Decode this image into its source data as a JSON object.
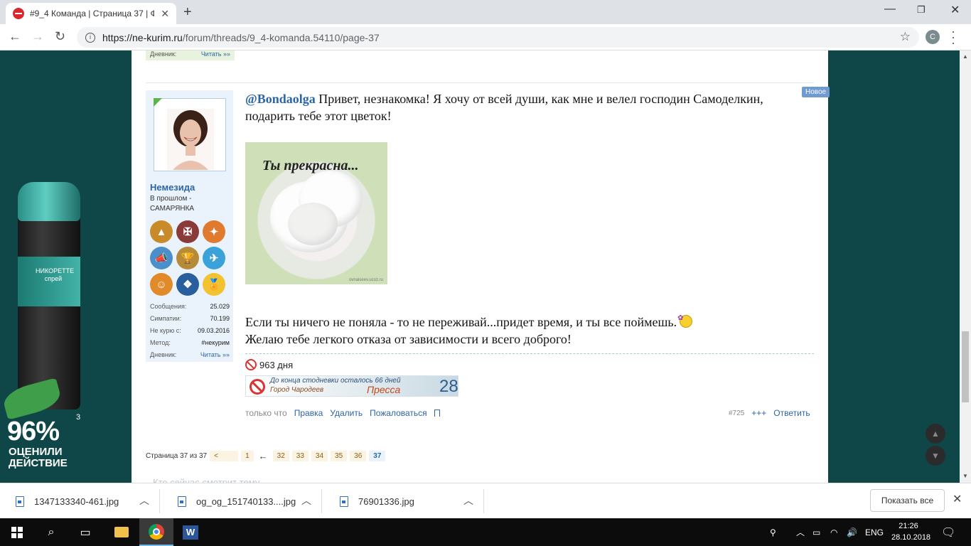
{
  "browser": {
    "tab_title": "#9_4 Команда | Страница 37 | Ф",
    "tab_close": "✕",
    "new_tab": "+",
    "url_host": "https://ne-kurim.ru",
    "url_path": "/forum/threads/9_4-komanda.54110/page-37",
    "profile_initial": "C"
  },
  "prev_post": {
    "diary_label": "Дневник:",
    "diary_link": "Читать »»"
  },
  "post": {
    "new_badge": "Новое",
    "mention": "@Bondaolga",
    "text1": " Привет, незнакомка! Я хочу от всей души, как мне и велел господин Самоделкин, подарить тебе этот цветок!",
    "image_caption": "Ты прекрасна...",
    "image_watermark": "ovnaiseev.ucoz.ru",
    "text2_line1": "Если ты ничего не поняла - то не переживай...придет время, и ты все поймешь.",
    "text2_line2": "Желаю тебе легкого отказа от зависимости и всего доброго!",
    "signature_days": "963 дня",
    "banner": {
      "line1": "До конца стодневки осталось 66 дней",
      "line2": "Город Чародеев",
      "line3": "Пресса",
      "number": "28"
    },
    "actions": {
      "time": "только что",
      "edit": "Правка",
      "delete": "Удалить",
      "report": "Пожаловаться",
      "number": "#725",
      "plus": "+++",
      "reply": "Ответить"
    }
  },
  "user": {
    "name": "Немезида",
    "title": "В прошлом - САМАРЯНКА",
    "stats": [
      {
        "label": "Сообщения:",
        "value": "25.029"
      },
      {
        "label": "Симпатии:",
        "value": "70.199"
      },
      {
        "label": "Не курю с:",
        "value": "09.03.2016"
      },
      {
        "label": "Метод:",
        "value": "#некурим"
      },
      {
        "label": "Дневник:",
        "value": "Читать »»"
      }
    ]
  },
  "pagination": {
    "label": "Страница 37 из 37",
    "prev": "<",
    "first": "1",
    "arrow": "←",
    "pages": [
      "32",
      "33",
      "34",
      "35",
      "36",
      "37"
    ]
  },
  "who_watching": "Кто сейчас смотрит тему",
  "ad": {
    "product": "НИКОРЕТТЕ спрей",
    "percent": "96%",
    "sup": "3",
    "line1": "ОЦЕНИЛИ",
    "line2": "ДЕЙСТВИЕ"
  },
  "downloads": {
    "items": [
      "1347133340-461.jpg",
      "og_og_151740133....jpg",
      "76901336.jpg"
    ],
    "show_all": "Показать все"
  },
  "taskbar": {
    "lang": "ENG",
    "time": "21:26",
    "date": "28.10.2018"
  }
}
